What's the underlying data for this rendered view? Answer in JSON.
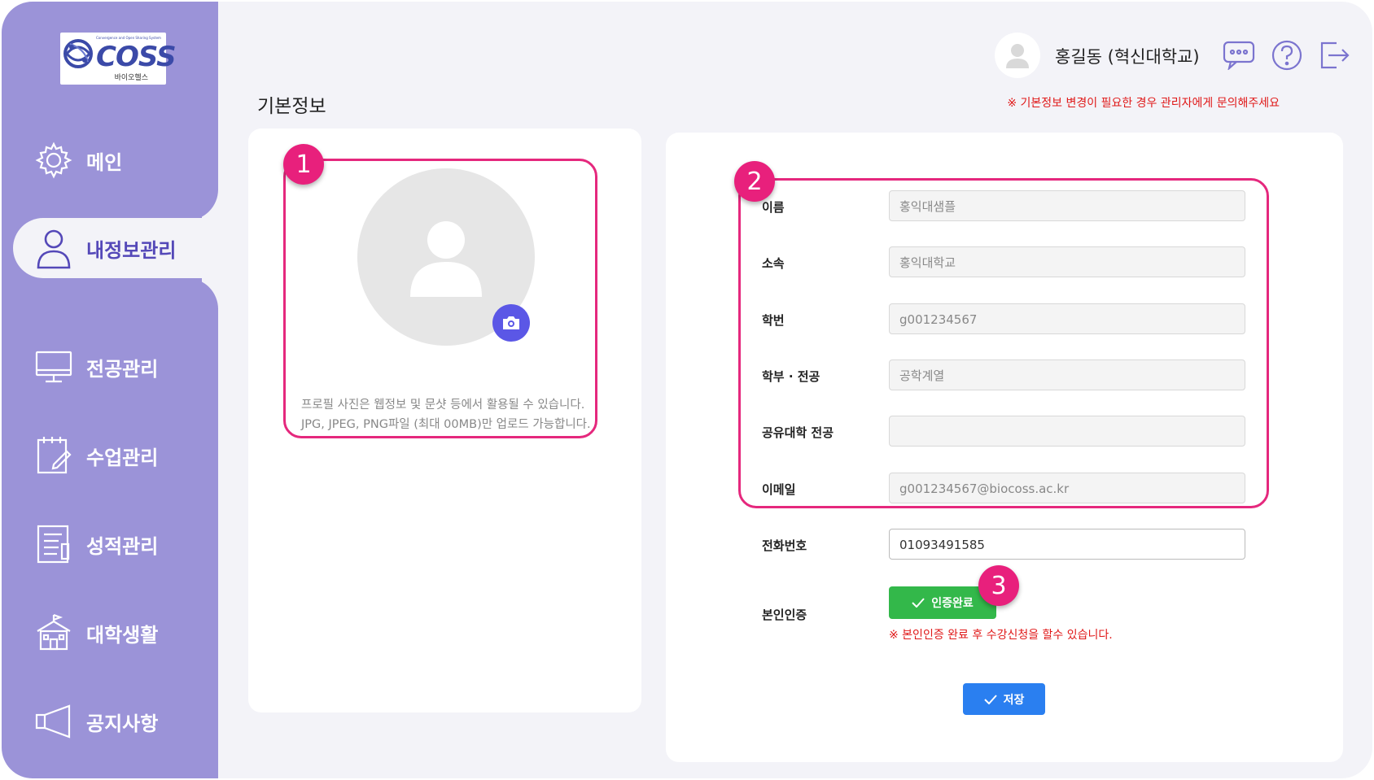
{
  "brand": {
    "logo_text": "COSS",
    "logo_tagline": "Convergence and Open Sharing System",
    "logo_sub": "바이오헬스"
  },
  "sidebar": {
    "items": [
      {
        "label": "메인",
        "icon": "gear-icon",
        "active": false
      },
      {
        "label": "내정보관리",
        "icon": "user-icon",
        "active": true
      },
      {
        "label": "전공관리",
        "icon": "monitor-icon",
        "active": false
      },
      {
        "label": "수업관리",
        "icon": "edit-note-icon",
        "active": false
      },
      {
        "label": "성적관리",
        "icon": "report-icon",
        "active": false
      },
      {
        "label": "대학생활",
        "icon": "school-icon",
        "active": false
      },
      {
        "label": "공지사항",
        "icon": "megaphone-icon",
        "active": false
      }
    ]
  },
  "header": {
    "user_name": "홍길동 (혁신대학교)",
    "icons": [
      "chat-icon",
      "help-icon",
      "logout-icon"
    ]
  },
  "page": {
    "title": "기본정보",
    "notice": "※ 기본정보 변경이 필요한 경우 관리자에게 문의해주세요"
  },
  "profile": {
    "help_line1": "프로필 사진은 웹정보 및 문샷 등에서 활용될 수 있습니다.",
    "help_line2": "JPG, JPEG, PNG파일 (최대 00MB)만 업로드 가능합니다."
  },
  "form": {
    "fields": [
      {
        "label": "이름",
        "value": "홍익대샘플"
      },
      {
        "label": "소속",
        "value": "홍익대학교"
      },
      {
        "label": "학번",
        "value": "g001234567"
      },
      {
        "label": "학부 · 전공",
        "value": "공학계열"
      },
      {
        "label": "공유대학 전공",
        "value": ""
      },
      {
        "label": "이메일",
        "value": "g001234567@biocoss.ac.kr"
      },
      {
        "label": "전화번호",
        "value": "01093491585"
      }
    ],
    "verify_label": "본인인증",
    "verify_button": "인증완료",
    "verify_note": "※ 본인인증 완료 후 수강신청을 할수 있습니다.",
    "save_button": "저장"
  },
  "annotations": {
    "badges": [
      "1",
      "2",
      "3"
    ],
    "highlight_color": "#e5287d"
  },
  "colors": {
    "sidebar": "#9b93d8",
    "active_text": "#5448b8",
    "verify": "#33b84a",
    "save": "#2a7ff0",
    "camera": "#5b57e6"
  }
}
